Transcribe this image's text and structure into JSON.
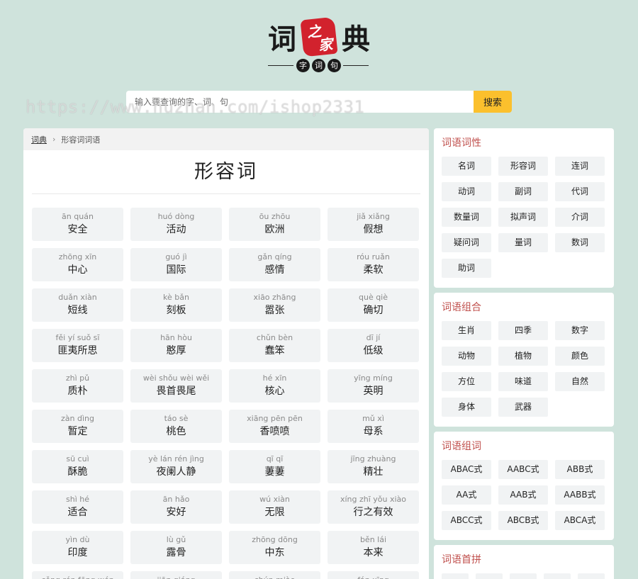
{
  "logo": {
    "main_chars": [
      "词",
      "典"
    ],
    "seal_chars": [
      "之",
      "家"
    ],
    "sub_chars": [
      "字",
      "词",
      "句"
    ]
  },
  "search": {
    "placeholder": "输入要查询的字、词、句",
    "button_label": "搜索"
  },
  "watermark": "https://www.huzhan.com/ishop2331",
  "breadcrumb": {
    "home": "词典",
    "current": "形容词词语"
  },
  "page_title": "形容词",
  "words": [
    {
      "py": "ān quán",
      "hz": "安全"
    },
    {
      "py": "huó dòng",
      "hz": "活动"
    },
    {
      "py": "ōu zhōu",
      "hz": "欧洲"
    },
    {
      "py": "jiǎ xiǎng",
      "hz": "假想"
    },
    {
      "py": "zhōng xīn",
      "hz": "中心"
    },
    {
      "py": "guó jì",
      "hz": "国际"
    },
    {
      "py": "gǎn qíng",
      "hz": "感情"
    },
    {
      "py": "róu ruǎn",
      "hz": "柔软"
    },
    {
      "py": "duǎn xiàn",
      "hz": "短线"
    },
    {
      "py": "kè bǎn",
      "hz": "刻板"
    },
    {
      "py": "xiāo zhāng",
      "hz": "嚣张"
    },
    {
      "py": "què qiè",
      "hz": "确切"
    },
    {
      "py": "fěi yí suǒ sī",
      "hz": "匪夷所思"
    },
    {
      "py": "hān hòu",
      "hz": "憨厚"
    },
    {
      "py": "chǔn bèn",
      "hz": "蠢笨"
    },
    {
      "py": "dī jí",
      "hz": "低级"
    },
    {
      "py": "zhì pǔ",
      "hz": "质朴"
    },
    {
      "py": "wèi shǒu wèi wěi",
      "hz": "畏首畏尾"
    },
    {
      "py": "hé xīn",
      "hz": "核心"
    },
    {
      "py": "yīng míng",
      "hz": "英明"
    },
    {
      "py": "zàn dìng",
      "hz": "暂定"
    },
    {
      "py": "táo sè",
      "hz": "桃色"
    },
    {
      "py": "xiāng pēn pēn",
      "hz": "香喷喷"
    },
    {
      "py": "mǔ xì",
      "hz": "母系"
    },
    {
      "py": "sū cuì",
      "hz": "酥脆"
    },
    {
      "py": "yè lán rén jìng",
      "hz": "夜阑人静"
    },
    {
      "py": "qī qī",
      "hz": "萋萋"
    },
    {
      "py": "jīng zhuàng",
      "hz": "精壮"
    },
    {
      "py": "shì hé",
      "hz": "适合"
    },
    {
      "py": "ān hǎo",
      "hz": "安好"
    },
    {
      "py": "wú xiàn",
      "hz": "无限"
    },
    {
      "py": "xíng zhī yǒu xiào",
      "hz": "行之有效"
    },
    {
      "py": "yìn dù",
      "hz": "印度"
    },
    {
      "py": "lù gǔ",
      "hz": "露骨"
    },
    {
      "py": "zhōng dōng",
      "hz": "中东"
    },
    {
      "py": "běn lái",
      "hz": "本来"
    },
    {
      "py": "cǒng rén fēng wén",
      "hz": ""
    },
    {
      "py": "jiān qiáng",
      "hz": ""
    },
    {
      "py": "chún miào",
      "hz": ""
    },
    {
      "py": "fán xīng",
      "hz": ""
    }
  ],
  "sidebar": {
    "pos": {
      "title": "词语词性",
      "items": [
        "名词",
        "形容词",
        "连词",
        "动词",
        "副词",
        "代词",
        "数量词",
        "拟声词",
        "介词",
        "疑问词",
        "量词",
        "数词",
        "助词"
      ]
    },
    "combo": {
      "title": "词语组合",
      "items": [
        "生肖",
        "四季",
        "数字",
        "动物",
        "植物",
        "颜色",
        "方位",
        "味道",
        "自然",
        "身体",
        "武器"
      ]
    },
    "pattern": {
      "title": "词语组词",
      "items": [
        "ABAC式",
        "AABC式",
        "ABB式",
        "AA式",
        "AAB式",
        "AABB式",
        "ABCC式",
        "ABCB式",
        "ABCA式"
      ]
    },
    "initial": {
      "title": "词语首拼"
    }
  }
}
